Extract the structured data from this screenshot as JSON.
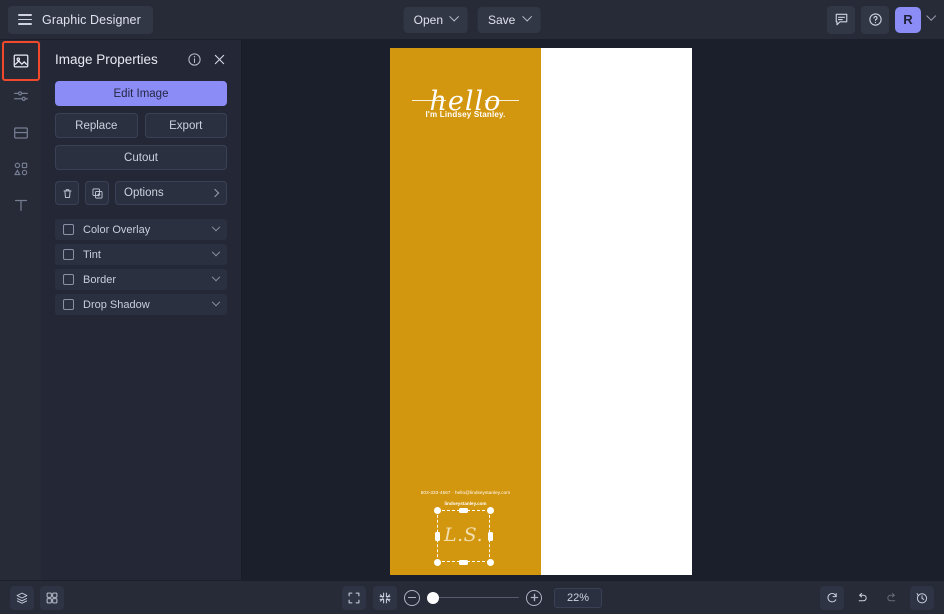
{
  "header": {
    "brand_title": "Graphic Designer",
    "menu_icon": "hamburger-icon",
    "open_label": "Open",
    "save_label": "Save",
    "chat_icon": "chat-icon",
    "help_icon": "help-circle-icon",
    "avatar_initial": "R",
    "accent_color": "#8c8cf7",
    "bar_color": "#272b38"
  },
  "rail": {
    "items": [
      {
        "name": "image-tool",
        "icon": "image-icon",
        "active": true
      },
      {
        "name": "adjustments-tool",
        "icon": "sliders-icon",
        "active": false
      },
      {
        "name": "layout-tool",
        "icon": "frame-icon",
        "active": false
      },
      {
        "name": "shapes-tool",
        "icon": "shapes-icon",
        "active": false
      },
      {
        "name": "text-tool",
        "icon": "text-t-icon",
        "active": false
      }
    ],
    "highlight_color": "#f0492b"
  },
  "panel": {
    "title": "Image Properties",
    "info_icon": "info-circle-icon",
    "close_icon": "close-x-icon",
    "edit_image_label": "Edit Image",
    "replace_label": "Replace",
    "export_label": "Export",
    "cutout_label": "Cutout",
    "delete_icon": "trash-icon",
    "duplicate_icon": "duplicate-icon",
    "options_label": "Options",
    "accordions": [
      {
        "label": "Color Overlay",
        "checked": false
      },
      {
        "label": "Tint",
        "checked": false
      },
      {
        "label": "Border",
        "checked": false
      },
      {
        "label": "Drop Shadow",
        "checked": false
      }
    ]
  },
  "canvas": {
    "left_page_color": "#d3960f",
    "right_page_color": "#ffffff",
    "headline": "hello",
    "subtitle": "I'm Lindsey Stanley.",
    "contact_line": "503-333-4567 · hello@lindseystanley.com",
    "website": "lindseystanley.com",
    "logo_text": "L.S.",
    "selected_element": "logo-text-element"
  },
  "bottombar": {
    "layers_icon": "layers-icon",
    "grid_icon": "grid-icon",
    "fit_screen_icon": "fit-to-screen-icon",
    "shrink_icon": "shrink-icon",
    "zoom_out_icon": "zoom-out-icon",
    "zoom_in_icon": "zoom-in-icon",
    "zoom_level": "22%",
    "refresh_icon": "refresh-icon",
    "undo_icon": "undo-icon",
    "redo_icon": "redo-icon",
    "history_icon": "history-icon"
  }
}
